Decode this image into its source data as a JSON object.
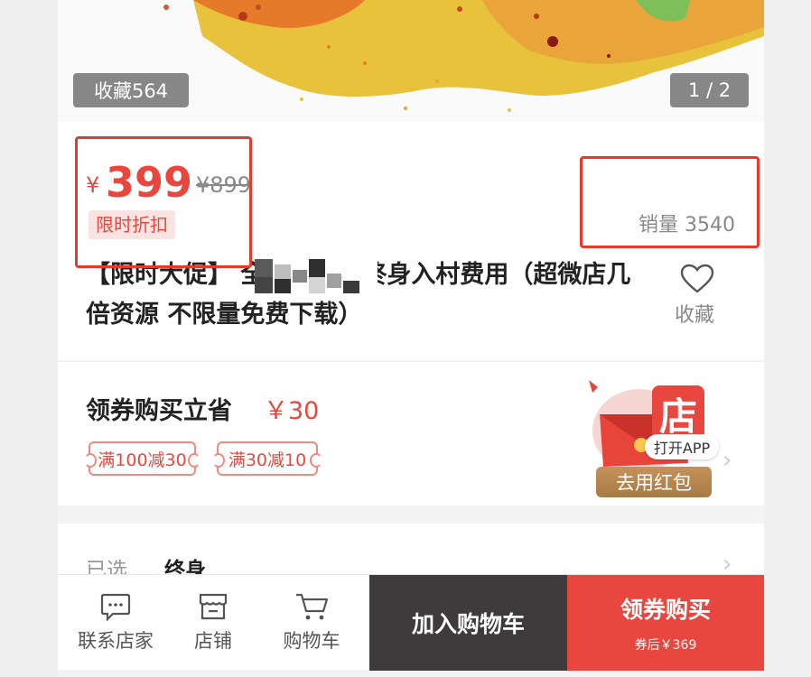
{
  "hero": {
    "favorite_count": "收藏564",
    "page_indicator": "1 / 2"
  },
  "product": {
    "currency": "¥",
    "price": "399",
    "original_price": "¥899",
    "flash_tag": "限时折扣",
    "sales": "销量 3540",
    "title": "【限时大促】 全新上线！终身入村费用（超微店几倍资源 不限量免费下载）",
    "favorite_label": "收藏"
  },
  "coupon": {
    "title": "领券购买立省",
    "amount": "￥30",
    "tickets": [
      "满100减30",
      "满30减10"
    ],
    "app_store_char": "店",
    "open_app": "打开APP",
    "use_redpack": "去用红包"
  },
  "selected": {
    "label": "已选",
    "value": "终身"
  },
  "bottom_bar": {
    "contact_label": "联系店家",
    "shop_label": "店铺",
    "cart_label": "购物车",
    "add_to_cart": "加入购物车",
    "buy_label": "领券购买",
    "buy_sub": "券后￥369"
  },
  "colors": {
    "accent": "#e8473f",
    "dark_button": "#3d3b3b",
    "annotation_frame": "#e53a2c"
  }
}
